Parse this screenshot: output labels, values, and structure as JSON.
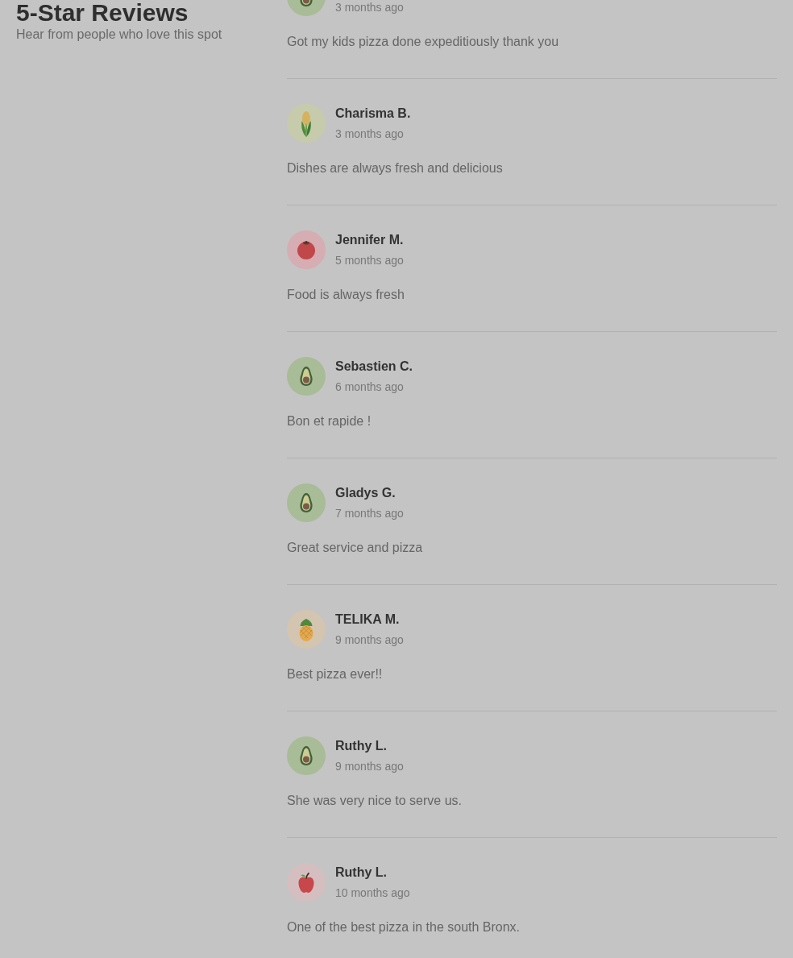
{
  "header": {
    "title": "5-Star Reviews",
    "subtitle": "Hear from people who love this spot"
  },
  "reviews": [
    {
      "avatar": {
        "kind": "avocado"
      },
      "date": "3 months ago",
      "text": "Got my kids pizza done expeditiously thank you"
    },
    {
      "name": "Charisma B.",
      "avatar": {
        "kind": "corn"
      },
      "date": "3 months ago",
      "text": "Dishes are always fresh and delicious"
    },
    {
      "name": "Jennifer M.",
      "avatar": {
        "kind": "tomato"
      },
      "date": "5 months ago",
      "text": "Food is always fresh"
    },
    {
      "name": "Sebastien C.",
      "avatar": {
        "kind": "avocado"
      },
      "date": "6 months ago",
      "text": "Bon et rapide !"
    },
    {
      "name": "Gladys G.",
      "avatar": {
        "kind": "avocado"
      },
      "date": "7 months ago",
      "text": "Great service and pizza"
    },
    {
      "name": "TELIKA M.",
      "avatar": {
        "kind": "pineapple"
      },
      "date": "9 months ago",
      "text": "Best pizza ever!!"
    },
    {
      "name": "Ruthy L.",
      "avatar": {
        "kind": "avocado"
      },
      "date": "9 months ago",
      "text": "She was very nice to serve us."
    },
    {
      "name": "Ruthy L.",
      "avatar": {
        "kind": "apple"
      },
      "date": "10 months ago",
      "text": "One of the best pizza in the south Bronx."
    }
  ]
}
